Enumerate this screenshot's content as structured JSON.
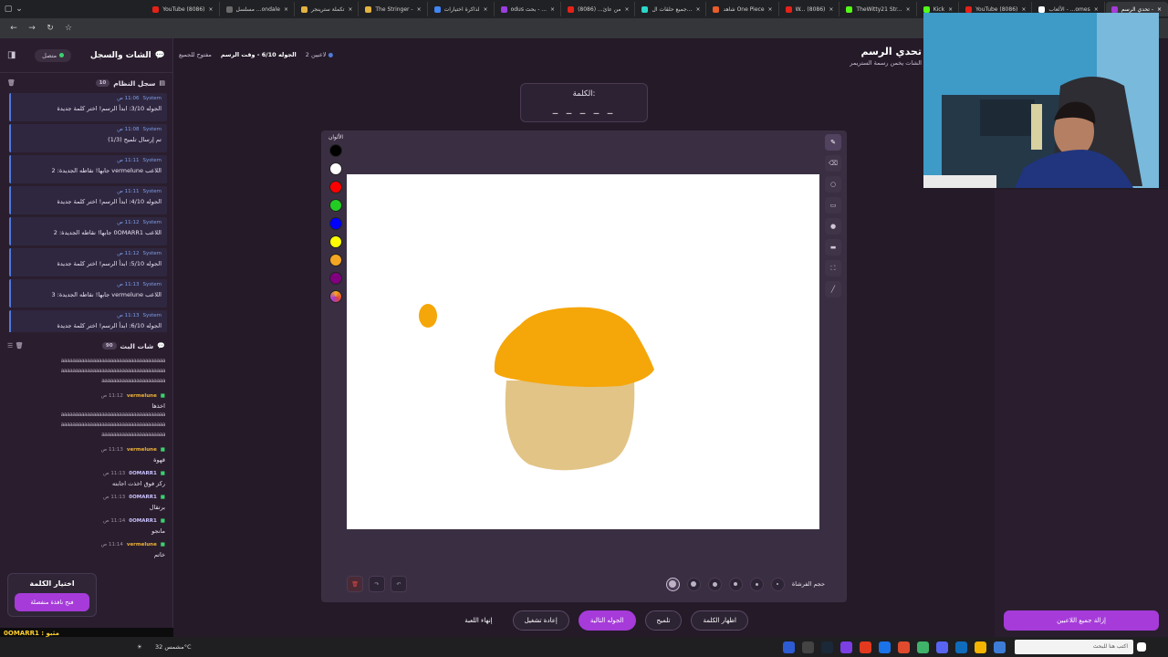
{
  "browser": {
    "tabs": [
      {
        "label": "YouTube (8086)",
        "color": "#e62117"
      },
      {
        "label": "مسلسل ...ondale",
        "color": "#6a6a6a"
      },
      {
        "label": "تكملة سترينجر",
        "color": "#e3b341"
      },
      {
        "label": "The Stringer -",
        "color": "#e3b341"
      },
      {
        "label": "لذاكرة اختيارات",
        "color": "#4285f4"
      },
      {
        "label": "odus بحث - ...",
        "color": "#9a3ee0"
      },
      {
        "label": "من عائ... (8086)",
        "color": "#e62117"
      },
      {
        "label": "جميع حلقات ال...",
        "color": "#2ad6c8"
      },
      {
        "label": "شاهد One Piece",
        "color": "#e85d2a"
      },
      {
        "label": "W... (8086)",
        "color": "#e62117"
      },
      {
        "label": "TheWitty21 Str...",
        "color": "#53fc18"
      },
      {
        "label": "Kick",
        "color": "#53fc18"
      },
      {
        "label": "YouTube (8086)",
        "color": "#e62117"
      },
      {
        "label": "الألعاب - ...omes",
        "color": "#ffffff"
      },
      {
        "label": "تحدي الرسم -",
        "color": "#a63bd9",
        "active": true
      }
    ],
    "search_placeholder": "اكتب هنا للبحث"
  },
  "sidebar": {
    "title": "الشات والسجل",
    "status": "متصل",
    "system_log": {
      "title": "سجل النظام",
      "count": "10",
      "items": [
        {
          "sender": "System",
          "time": "11:06 ص",
          "text": "الجوله 3/10: ابدأ الرسم! اختر كلمة جديدة"
        },
        {
          "sender": "System",
          "time": "11:08 ص",
          "text": "تم إرسال تلميح (1/3)"
        },
        {
          "sender": "System",
          "time": "11:11 ص",
          "text": "اللاعب vermelune جابها! نقاطه الجديدة: 2"
        },
        {
          "sender": "System",
          "time": "11:11 ص",
          "text": "الجوله 4/10: ابدأ الرسم! اختر كلمة جديدة"
        },
        {
          "sender": "System",
          "time": "11:12 ص",
          "text": "اللاعب 0OMARR1 جابها! نقاطه الجديدة: 2"
        },
        {
          "sender": "System",
          "time": "11:12 ص",
          "text": "الجوله 5/10: ابدأ الرسم! اختر كلمة جديدة"
        },
        {
          "sender": "System",
          "time": "11:13 ص",
          "text": "اللاعب vermelune جابها! نقاطه الجديدة: 3"
        },
        {
          "sender": "System",
          "time": "11:13 ص",
          "text": "الجوله 6/10: ابدأ الرسم! اختر كلمة جديدة"
        }
      ]
    },
    "chat": {
      "title": "شات البث",
      "count": "90",
      "spam": [
        "aaaaaaaaaaaaaaaaaaaaaaaaaaaaaaaaaaaa",
        "aaaaaaaaaaaaaaaaaaaaaaaaaaaaaaaaaaaa",
        "aaaaaaaaaaaaaaaaaaaaaa"
      ],
      "messages": [
        {
          "user": "vermelune",
          "time": "11:12 ص",
          "text": "اخذها"
        },
        {
          "user": "vermelune",
          "time": "11:13 ص",
          "text": "قهوة"
        },
        {
          "user": "0OMARR1",
          "time": "11:13 ص",
          "text": "ركز فوق اخذت اجابته"
        },
        {
          "user": "0OMARR1",
          "time": "11:13 ص",
          "text": "برتقال"
        },
        {
          "user": "0OMARR1",
          "time": "11:14 ص",
          "text": "مانجو"
        },
        {
          "user": "vermelune",
          "time": "11:14 ص",
          "text": "خاتم"
        }
      ],
      "spam2": [
        "aaaaaaaaaaaaaaaaaaaaaaaaaaaaaaaaaaaa",
        "aaaaaaaaaaaaaaaaaaaaaaaaaaaaaaaaaaaa",
        "aaaaaaaaaaaaaaaaaaaaaa"
      ]
    },
    "word_pick": {
      "title": "اختيار الكلمة",
      "button": "فتح نافذة منفصلة"
    },
    "ticker": "مثبو : 0OMARR1"
  },
  "game": {
    "players": "2 لاعبين",
    "round": "الجوله 6/10 - وقت الرسم",
    "mode": "مفتوح للجميع",
    "title": "تحدي الرسم",
    "subtitle": "الشات يخمن رسمة الستريمر",
    "word_label": "الكلمة:",
    "word_mask": "_ _ _ _ _",
    "colors_label": "الألوان",
    "colors": [
      "#000000",
      "#ffffff",
      "#ff0000",
      "#22cc22",
      "#0000ff",
      "#ffff00",
      "#f5a623",
      "#800080",
      "#f5a623"
    ],
    "brush_label": "حجم الفرشاة",
    "actions": {
      "end": "إنهاء اللعبة",
      "restart": "إعادة تشغيل",
      "next": "الجوله التالية",
      "hint": "تلميح",
      "reveal": "اظهار الكلمة"
    },
    "remove_all": "إزالة جميع اللاعبين"
  },
  "taskbar": {
    "weather": "مشمس 32°C",
    "search": "اكتب هنا للبحث"
  }
}
